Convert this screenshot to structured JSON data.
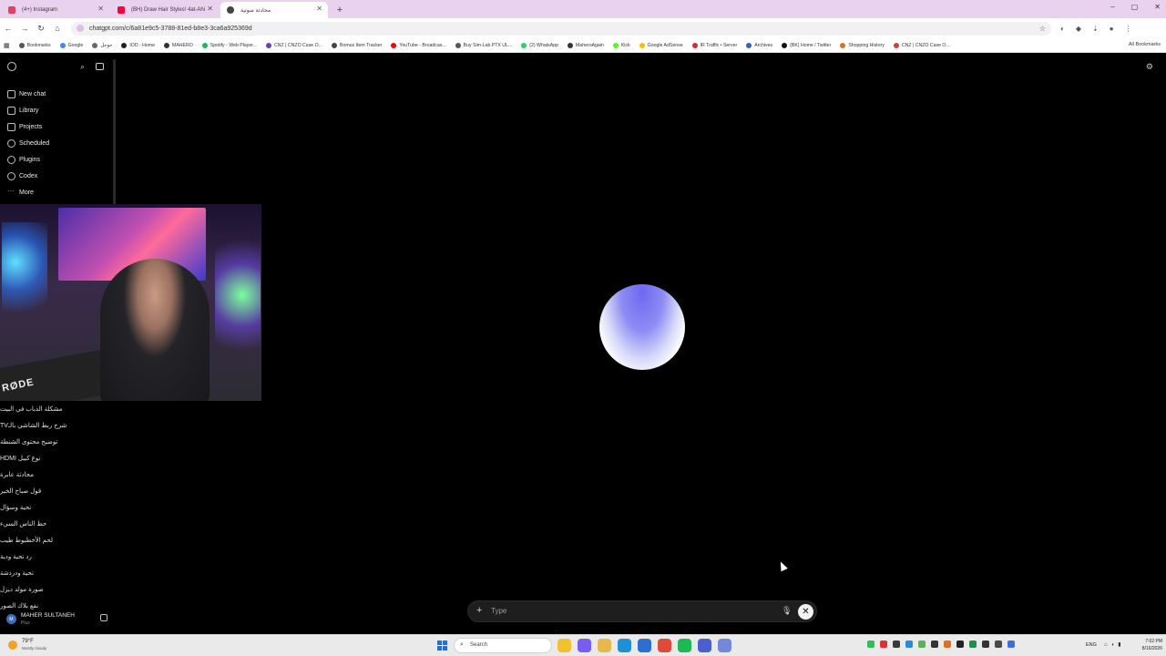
{
  "browser": {
    "tabs": [
      {
        "title": "(4+) Instagram",
        "favicon_color": "#e4405f",
        "active": false
      },
      {
        "title": "(BH) Draw Hair Styles! 4at-Ahi",
        "favicon_color": "#ff0033",
        "active": false
      },
      {
        "title": "محادثة صوتية",
        "favicon_color": "#444444",
        "active": true
      }
    ],
    "new_tab": "+",
    "url": "chatgpt.com/c/6a81e9c5-3788-81ed-b8e3-3ca6a925369d",
    "window_controls": [
      "–",
      "▢",
      "✕"
    ],
    "bookmarks": [
      {
        "label": "Bookmarks",
        "color": "#555555"
      },
      {
        "label": "Google",
        "color": "#4285f4"
      },
      {
        "label": "جوجل",
        "color": "#666666"
      },
      {
        "label": "IOD - Home",
        "color": "#222222"
      },
      {
        "label": "MAHERO",
        "color": "#333333"
      },
      {
        "label": "Spotify - Web Player...",
        "color": "#1db954"
      },
      {
        "label": "CNZ | CNZO Case O...",
        "color": "#6a3fb5"
      },
      {
        "label": "Bomus Item Tracker",
        "color": "#444444"
      },
      {
        "label": "YouTube - Broadcas...",
        "color": "#ff0000"
      },
      {
        "label": "Buy Sim-Lab PTX UL...",
        "color": "#555555"
      },
      {
        "label": "(2) WhatsApp",
        "color": "#25d366"
      },
      {
        "label": "MaheroAgain",
        "color": "#333333"
      },
      {
        "label": "Kick",
        "color": "#53fc18"
      },
      {
        "label": "Google AdSense",
        "color": "#fbbc04"
      },
      {
        "label": "IR Traffic • Server",
        "color": "#d03030"
      },
      {
        "label": "Archives",
        "color": "#3060c0"
      },
      {
        "label": "(BK) Home / Twitter",
        "color": "#111111"
      },
      {
        "label": "Shopping History",
        "color": "#e07020"
      },
      {
        "label": "CNZ | CNZO Case O...",
        "color": "#d04040"
      }
    ],
    "all_bookmarks": "All Bookmarks"
  },
  "sidebar": {
    "nav": [
      {
        "label": "New chat",
        "icon": "new-chat-icon"
      },
      {
        "label": "Library",
        "icon": "library-icon"
      },
      {
        "label": "Projects",
        "icon": "folder-icon"
      },
      {
        "label": "Scheduled",
        "icon": "clock-icon"
      },
      {
        "label": "Plugins",
        "icon": "plugin-icon"
      },
      {
        "label": "Codex",
        "icon": "codex-icon"
      },
      {
        "label": "More",
        "icon": "more-icon"
      }
    ],
    "history": [
      "مشكلة الذباب في البيت",
      "شرح ربط الشاشي بالـTV",
      "توضيح محتوى الشنطة",
      "نوع كيبل HDMI",
      "محادثة عابرة",
      "قول صباح الخير",
      "تحية وسؤال",
      "حظ الناس السيء",
      "لحم الأخطبوط طيب",
      "رد تحية ودية",
      "تحية ودردشة",
      "صورة مولد ديزل",
      "نفع بلاك الصور"
    ],
    "user": {
      "name": "MAHER SULTANEH",
      "plan": "Plus",
      "initials": "M"
    }
  },
  "webcam": {
    "brand": "RØDE"
  },
  "composer": {
    "placeholder": "Type",
    "plus": "+",
    "close": "✕"
  },
  "taskbar": {
    "weather": {
      "temp": "79°F",
      "condition": "Mostly cloudy"
    },
    "search_placeholder": "Search",
    "apps": [
      {
        "name": "file-explorer",
        "color": "#f2c12e"
      },
      {
        "name": "copilot",
        "color": "#7a5cf0"
      },
      {
        "name": "folder",
        "color": "#e8b84a"
      },
      {
        "name": "edge",
        "color": "#1f8fd8"
      },
      {
        "name": "store",
        "color": "#2c6fd0"
      },
      {
        "name": "chrome",
        "color": "#e04a3a"
      },
      {
        "name": "spotify",
        "color": "#1db954"
      },
      {
        "name": "teams",
        "color": "#4b5fd0"
      },
      {
        "name": "discord",
        "color": "#7289da"
      }
    ],
    "tray_colors": [
      "#2fbf5a",
      "#e03030",
      "#3a3a3a",
      "#2b8ad8",
      "#5ab35a",
      "#333333",
      "#e07020",
      "#222222",
      "#1d8f4d",
      "#333333",
      "#4a4a4a",
      "#3d6fd8"
    ],
    "language": "ENG",
    "time": "7:02 PM",
    "date": "8/16/2026"
  }
}
